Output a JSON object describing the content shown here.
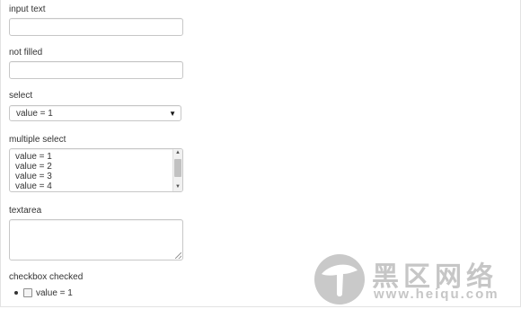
{
  "form": {
    "input_text": {
      "label": "input text",
      "value": ""
    },
    "not_filled": {
      "label": "not filled",
      "value": ""
    },
    "select": {
      "label": "select",
      "value": "value = 1"
    },
    "multiple_select": {
      "label": "multiple select",
      "options": [
        "value = 1",
        "value = 2",
        "value = 3",
        "value = 4"
      ]
    },
    "textarea": {
      "label": "textarea",
      "value": ""
    },
    "checkbox": {
      "label": "checkbox checked",
      "item_label": "value = 1",
      "checked": false
    }
  },
  "watermark": {
    "site_name": "黑区网络",
    "url": "www.heiqu.com"
  }
}
